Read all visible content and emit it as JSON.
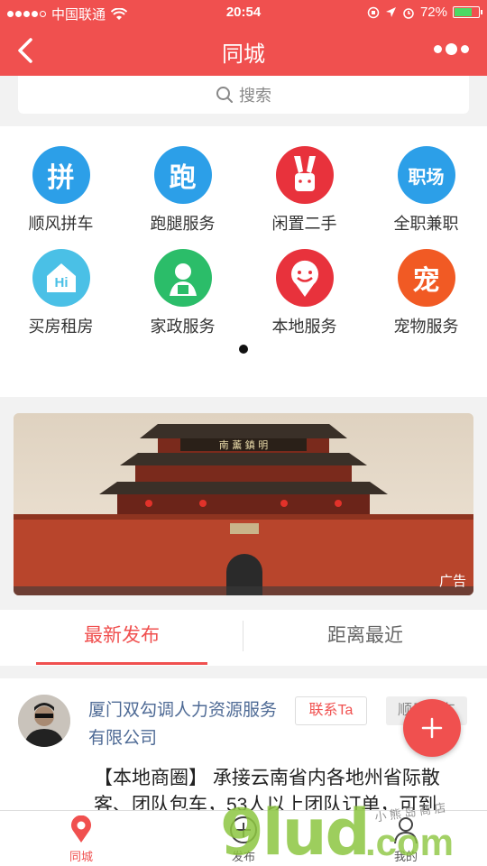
{
  "status_bar": {
    "carrier": "中国联通",
    "time": "20:54",
    "battery": "72%",
    "battery_level": 0.72
  },
  "nav": {
    "title": "同城"
  },
  "search": {
    "placeholder": "搜索"
  },
  "categories": [
    {
      "label": "顺风拼车",
      "glyph": "拼",
      "color": "#2c9fe8",
      "icon": "carpool-icon"
    },
    {
      "label": "跑腿服务",
      "glyph": "跑",
      "color": "#2c9fe8",
      "icon": "errand-icon"
    },
    {
      "label": "闲置二手",
      "glyph": "",
      "color": "#e8323c",
      "icon": "bunny-icon"
    },
    {
      "label": "全职兼职",
      "glyph": "职场",
      "color": "#2c9fe8",
      "icon": "job-icon"
    },
    {
      "label": "买房租房",
      "glyph": "Hi",
      "color": "#4ac0e6",
      "icon": "house-icon"
    },
    {
      "label": "家政服务",
      "glyph": "",
      "color": "#2bbd69",
      "icon": "housekeeper-icon"
    },
    {
      "label": "本地服务",
      "glyph": "",
      "color": "#e8323c",
      "icon": "smiley-pin-icon"
    },
    {
      "label": "宠物服务",
      "glyph": "宠",
      "color": "#f15a24",
      "icon": "pet-icon"
    }
  ],
  "banner": {
    "ad_label": "广告",
    "sign_text": "南 薰 鎮 明"
  },
  "tabs": [
    {
      "label": "最新发布",
      "active": true
    },
    {
      "label": "距离最近",
      "active": false
    }
  ],
  "post": {
    "company": "厦门双勾调人力资源服务有限公司",
    "contact": "联系Ta",
    "tag": "顺风拼车",
    "content": "【本地商圈】 承接云南省内各地州省际散客、团队包车，53人以上团队订单，可到"
  },
  "tab_bar": [
    {
      "label": "同城",
      "icon": "location-pin-icon",
      "active": true
    },
    {
      "label": "发布",
      "icon": "plus-circle-icon",
      "active": false
    },
    {
      "label": "我的",
      "icon": "person-icon",
      "active": false
    }
  ],
  "watermark": {
    "text": "9lud",
    "suffix": ".com",
    "small": "小 熊 岛 商 店"
  }
}
